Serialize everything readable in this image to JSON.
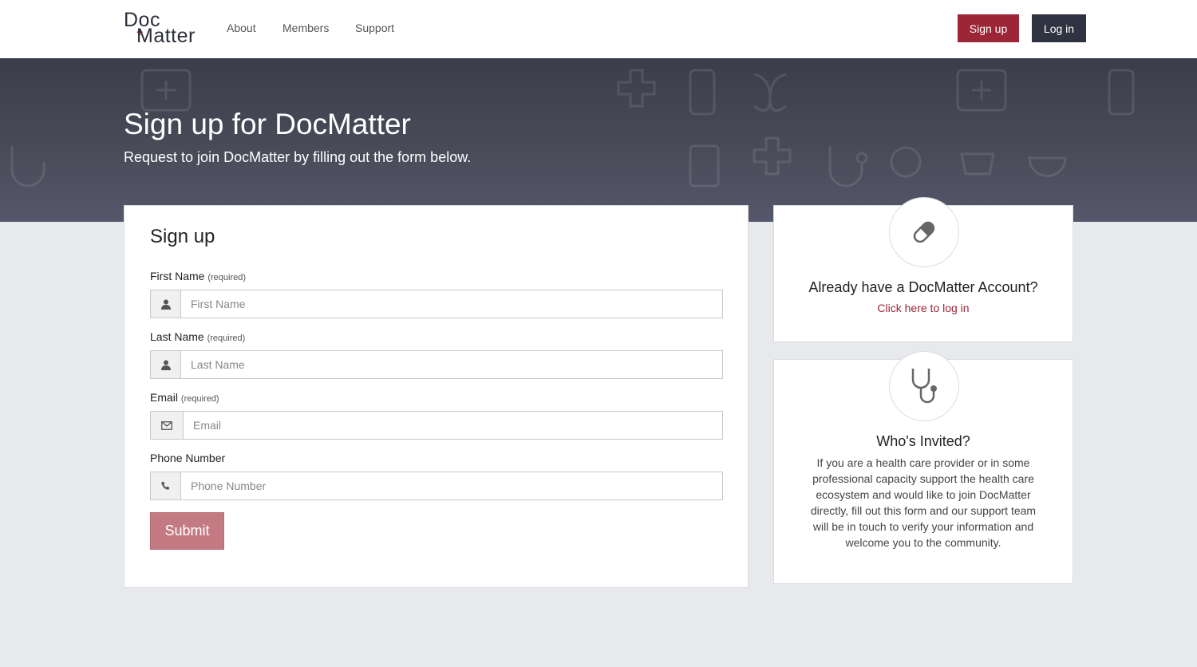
{
  "header": {
    "logo_line1": "Doc",
    "logo_line2": "Matter",
    "nav": [
      "About",
      "Members",
      "Support"
    ],
    "signup_label": "Sign up",
    "login_label": "Log in"
  },
  "hero": {
    "title": "Sign up for DocMatter",
    "subtitle": "Request to join DocMatter by filling out the form below."
  },
  "form": {
    "heading": "Sign up",
    "fields": [
      {
        "label": "First Name",
        "note": "(required)",
        "placeholder": "First Name",
        "icon": "user-icon"
      },
      {
        "label": "Last Name",
        "note": "(required)",
        "placeholder": "Last Name",
        "icon": "user-icon"
      },
      {
        "label": "Email",
        "note": "(required)",
        "placeholder": "Email",
        "icon": "envelope-icon"
      },
      {
        "label": "Phone Number",
        "note": "",
        "placeholder": "Phone Number",
        "icon": "phone-icon"
      }
    ],
    "submit_label": "Submit"
  },
  "login_card": {
    "icon": "pill-icon",
    "title": "Already have a DocMatter Account?",
    "link": "Click here to log in"
  },
  "invite_card": {
    "icon": "stethoscope-icon",
    "title": "Who's Invited?",
    "text": "If you are a health care provider or in some professional capacity support the health care ecosystem and would like to join DocMatter directly, fill out this form and our support team will be in touch to verify your information and welcome you to the community."
  },
  "colors": {
    "brand": "#9c2536",
    "dark": "#2f3240",
    "submit": "#c47a82"
  }
}
